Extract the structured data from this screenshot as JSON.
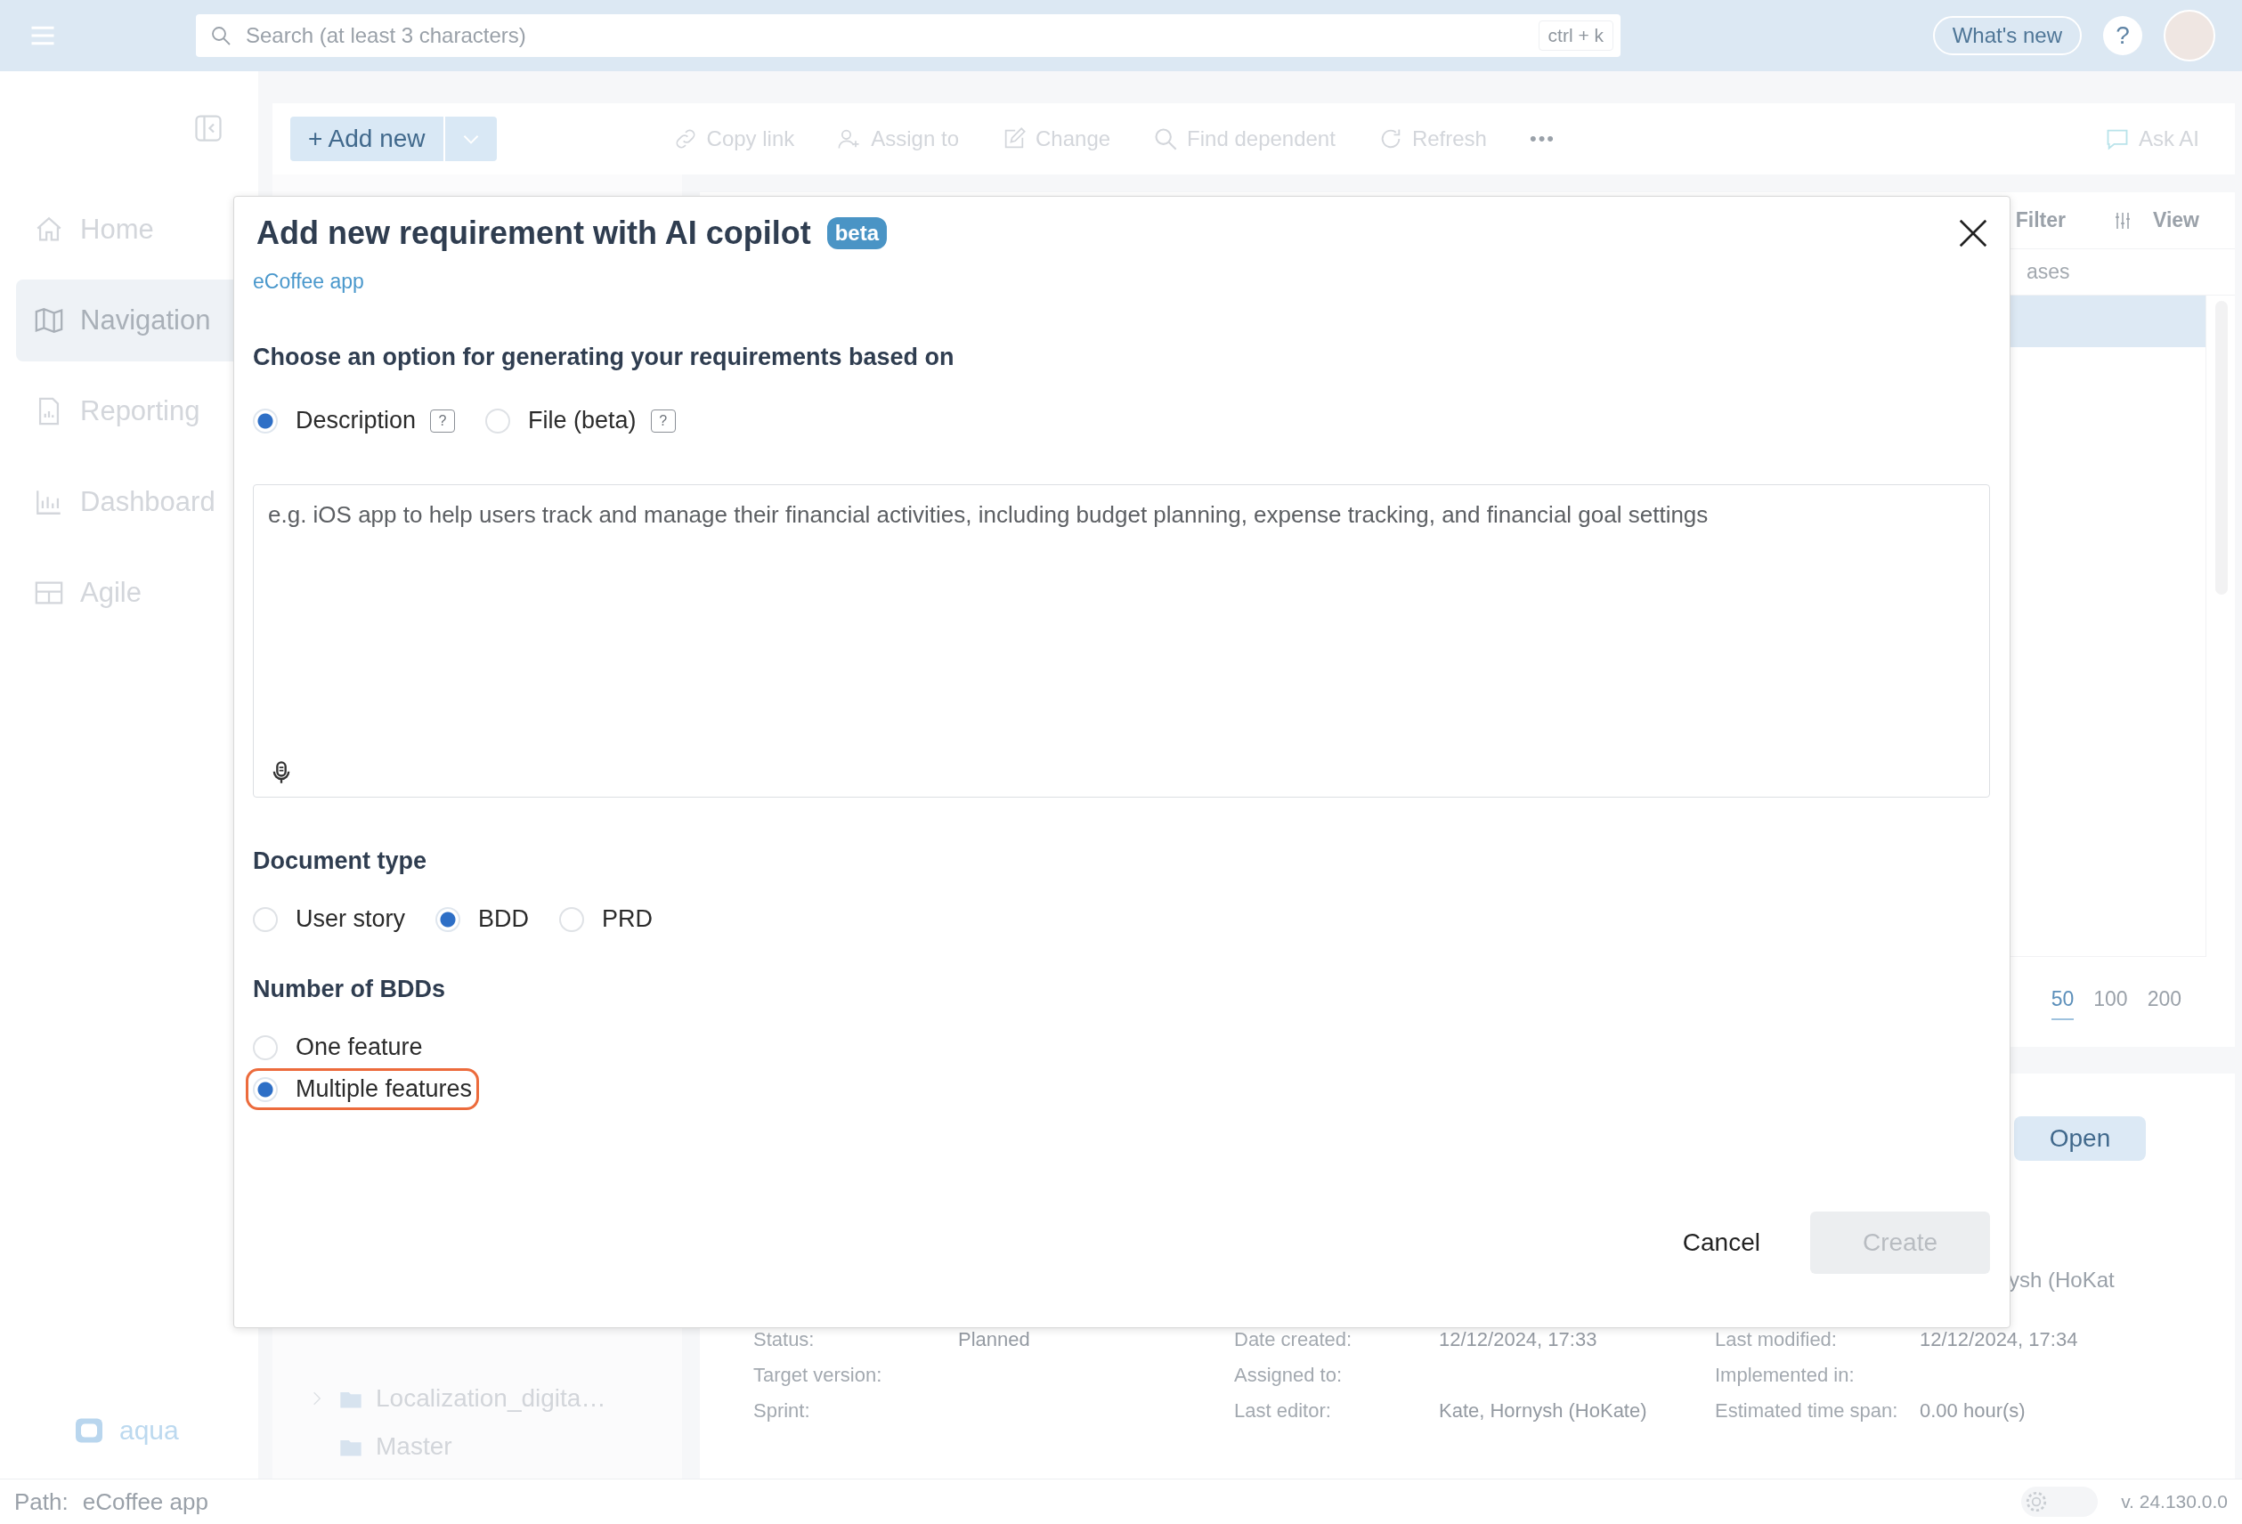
{
  "top_bar": {
    "search": {
      "placeholder": "Search (at least 3 characters)",
      "shortcut": "ctrl + k"
    },
    "whats_new": "What's new",
    "help": "?"
  },
  "toolbar": {
    "add_new": "+ Add new",
    "actions": [
      {
        "kind": "link",
        "label": "Copy link"
      },
      {
        "kind": "assign",
        "label": "Assign to"
      },
      {
        "kind": "edit",
        "label": "Change"
      },
      {
        "kind": "search",
        "label": "Find dependent"
      },
      {
        "kind": "refresh",
        "label": "Refresh"
      }
    ],
    "more": "•••",
    "ask_ai": "Ask AI"
  },
  "sidebar": {
    "items": [
      {
        "kind": "home",
        "label": "Home",
        "selected": false
      },
      {
        "kind": "map",
        "label": "Navigation",
        "selected": true
      },
      {
        "kind": "report",
        "label": "Reporting",
        "selected": false
      },
      {
        "kind": "chart",
        "label": "Dashboard",
        "selected": false
      },
      {
        "kind": "grid",
        "label": "Agile",
        "selected": false
      }
    ],
    "logo": "aqua"
  },
  "tree": {
    "items": [
      "Localization_digita…",
      "Master"
    ]
  },
  "list_panel": {
    "filter": "Filter",
    "view": "View",
    "column_1": "ases",
    "pagination": [
      {
        "label": "50",
        "selected": true
      },
      {
        "label": "100",
        "selected": false
      },
      {
        "label": "200",
        "selected": false
      }
    ]
  },
  "details": {
    "open": "Open",
    "fragment": "ysh (HoKat",
    "fields": [
      {
        "label": "Status:",
        "value": "Planned"
      },
      {
        "label": "Date created:",
        "value": "12/12/2024, 17:33"
      },
      {
        "label": "Last modified:",
        "value": "12/12/2024, 17:34"
      },
      {
        "label": "Target version:"
      },
      {
        "label": "Assigned to:"
      },
      {
        "label": "Implemented in:"
      },
      {
        "label": "Sprint:"
      },
      {
        "label": "Last editor:",
        "value": "Kate, Hornysh (HoKate)"
      },
      {
        "label": "Estimated time span:",
        "value": "0.00 hour(s)"
      }
    ]
  },
  "status_bar": {
    "path_label": "Path:",
    "path": "eCoffee app",
    "theme_toggle": {
      "on": false
    },
    "version": "v. 24.130.0.0"
  },
  "dialog": {
    "title": "Add new requirement with AI copilot",
    "badge": "beta",
    "project": "eCoffee app",
    "source_heading": "Choose an option for generating your requirements based on",
    "source_options": [
      {
        "label": "Description",
        "selected": true,
        "help": "?"
      },
      {
        "label": "File (beta)",
        "selected": false,
        "help": "?"
      }
    ],
    "description": {
      "placeholder": "e.g. iOS app to help users track and manage their financial activities, including budget planning, expense tracking, and financial goal settings"
    },
    "document_type": {
      "label": "Document type",
      "options": [
        {
          "label": "User story",
          "selected": false
        },
        {
          "label": "BDD",
          "selected": true
        },
        {
          "label": "PRD",
          "selected": false
        }
      ]
    },
    "number_of_bdds": {
      "label": "Number of BDDs",
      "options": [
        {
          "label": "One feature",
          "selected": false,
          "highlighted": false
        },
        {
          "label": "Multiple features",
          "selected": true,
          "highlighted": true
        }
      ]
    },
    "buttons": [
      {
        "kind": "cancel",
        "label": "Cancel"
      },
      {
        "kind": "create",
        "label": "Create",
        "disabled": true
      }
    ]
  }
}
